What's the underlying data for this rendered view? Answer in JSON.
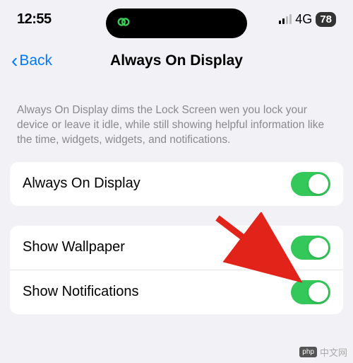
{
  "statusBar": {
    "time": "12:55",
    "network": "4G",
    "battery": "78"
  },
  "nav": {
    "back": "Back",
    "title": "Always On Display"
  },
  "description": "Always On Display dims the Lock Screen wen you lock your device or leave it idle, while still showing helpful information like the time, widgets, widgets, and notifications.",
  "group1": {
    "row1": {
      "label": "Always On Display",
      "on": true
    }
  },
  "group2": {
    "row1": {
      "label": "Show Wallpaper",
      "on": true
    },
    "row2": {
      "label": "Show Notifications",
      "on": true
    }
  },
  "watermark": {
    "logo": "php",
    "text": "中文网"
  }
}
